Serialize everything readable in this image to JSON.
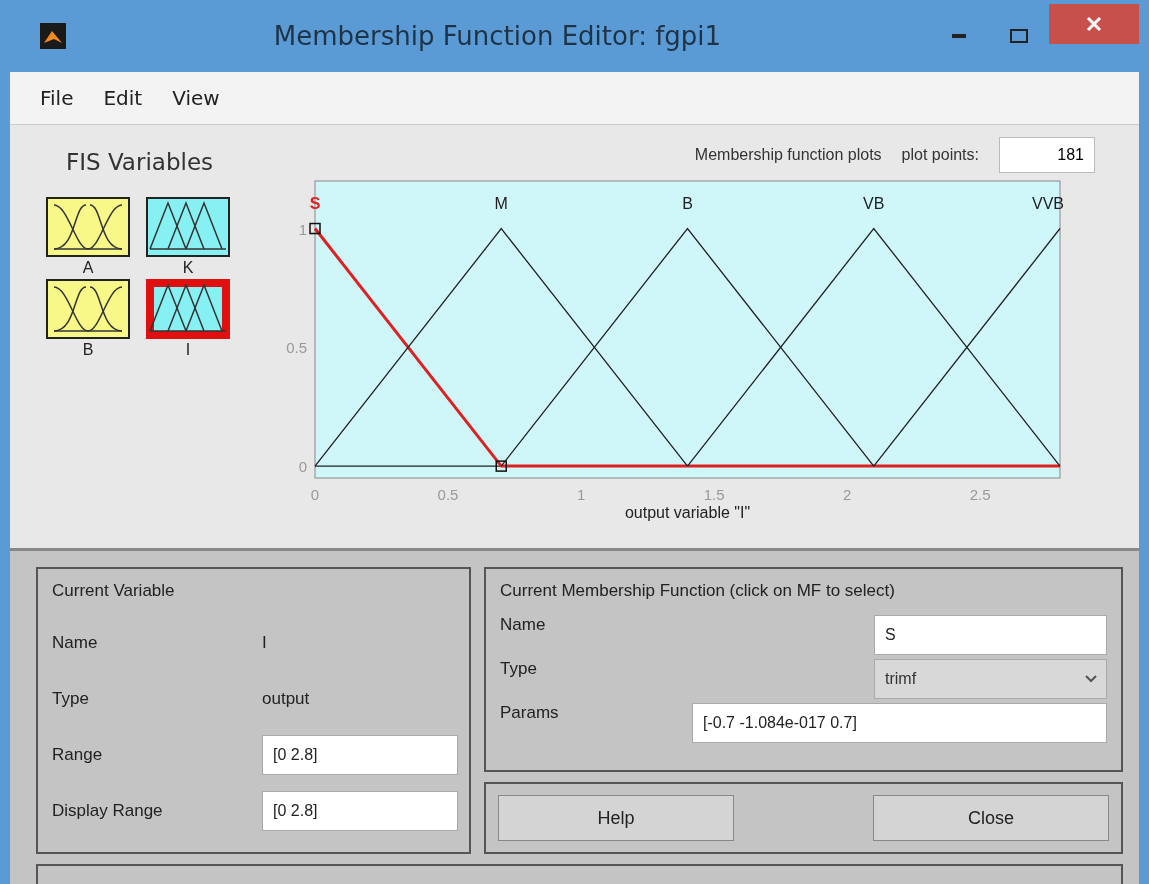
{
  "window": {
    "title": "Membership Function Editor: fgpi1"
  },
  "menu": [
    "File",
    "Edit",
    "View"
  ],
  "fis_variables": {
    "title": "FIS Variables",
    "items": [
      {
        "name": "A",
        "kind": "input",
        "selected": false
      },
      {
        "name": "K",
        "kind": "output",
        "selected": false
      },
      {
        "name": "B",
        "kind": "input",
        "selected": false
      },
      {
        "name": "I",
        "kind": "output",
        "selected": true
      }
    ]
  },
  "plot": {
    "plot_points_label": "plot points:",
    "plot_points": "181",
    "chart_data": {
      "type": "line",
      "title": "Membership function plots",
      "xlabel": "output variable \"I\"",
      "x": [
        0,
        0.7,
        1.4,
        2.1,
        2.8
      ],
      "xlim": [
        0,
        2.8
      ],
      "ylim": [
        -0.05,
        1.2
      ],
      "xticks": [
        0,
        0.5,
        1,
        1.5,
        2,
        2.5
      ],
      "yticks": [
        0,
        0.5,
        1
      ],
      "series": [
        {
          "name": "S",
          "color": "#e02020",
          "values": [
            1,
            0,
            0,
            0,
            0
          ]
        },
        {
          "name": "M",
          "color": "#202020",
          "values": [
            0,
            1,
            0,
            null,
            null
          ]
        },
        {
          "name": "B",
          "color": "#202020",
          "values": [
            null,
            0,
            1,
            0,
            null
          ]
        },
        {
          "name": "VB",
          "color": "#202020",
          "values": [
            null,
            null,
            0,
            1,
            0
          ]
        },
        {
          "name": "VVB",
          "color": "#202020",
          "values": [
            null,
            null,
            null,
            0,
            1
          ]
        }
      ]
    }
  },
  "current_variable": {
    "title": "Current Variable",
    "name_label": "Name",
    "name": "I",
    "type_label": "Type",
    "type": "output",
    "range_label": "Range",
    "range": "[0 2.8]",
    "display_range_label": "Display Range",
    "display_range": "[0 2.8]"
  },
  "current_mf": {
    "title": "Current Membership Function (click on MF to select)",
    "name_label": "Name",
    "name": "S",
    "type_label": "Type",
    "type": "trimf",
    "params_label": "Params",
    "params": "[-0.7 -1.084e-017 0.7]"
  },
  "buttons": [
    "Help",
    "Close"
  ]
}
